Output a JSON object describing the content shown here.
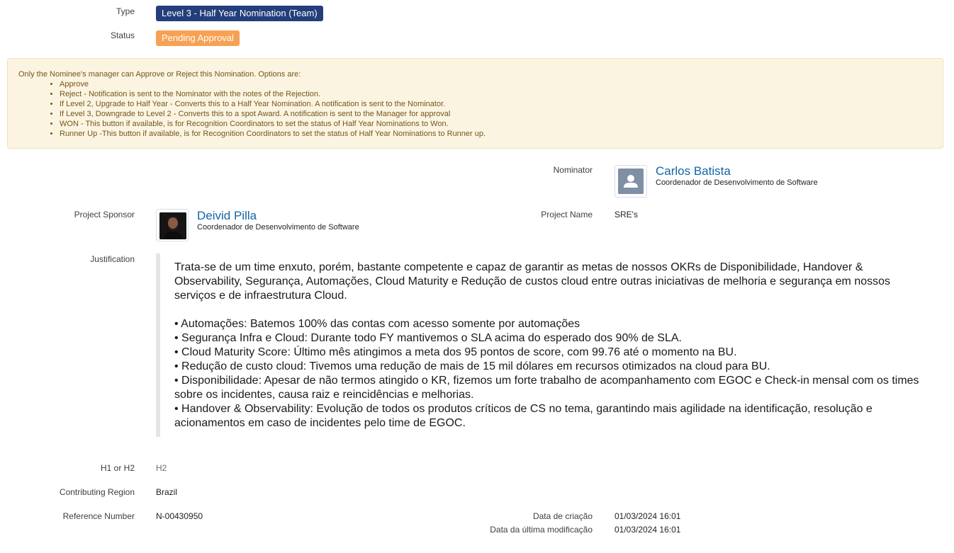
{
  "type": {
    "label": "Type",
    "value": "Level 3 - Half Year Nomination (Team)",
    "color": "#243e7b"
  },
  "status": {
    "label": "Status",
    "value": "Pending Approval",
    "color": "#f6a154"
  },
  "notice": {
    "intro": "Only the Nominee's manager can Approve or Reject this Nomination. Options are:",
    "items": [
      "Approve",
      "Reject - Notification is sent to the Nominator with the notes of the Rejection.",
      "If Level 2, Upgrade to Half Year - Converts this to a Half Year Nomination. A notification is sent to the Nominator.",
      "If Level 3, Downgrade to Level 2 - Converts this to a spot Award. A notification is sent to the Manager for approval",
      "WON - This button if available, is for Recognition Coordinators to set the status of Half Year Nominations to Won.",
      "Runner Up -This button if available, is for Recognition Coordinators to set the status of Half Year Nominations to Runner up."
    ]
  },
  "nominator": {
    "label": "Nominator",
    "name": "Carlos Batista",
    "title": "Coordenador de Desenvolvimento de Software",
    "avatar_icon": "user-placeholder-icon"
  },
  "project_sponsor": {
    "label": "Project Sponsor",
    "name": "Deivid Pilla",
    "title": "Coordenador de Desenvolvimento de Software",
    "avatar_icon": "user-photo-icon"
  },
  "project_name": {
    "label": "Project Name",
    "value": "SRE's"
  },
  "justification": {
    "label": "Justification",
    "intro": "Trata-se de um time enxuto, porém, bastante competente e capaz de garantir as metas de nossos OKRs de Disponibilidade, Handover & Observability, Segurança, Automações, Cloud Maturity e Redução de custos cloud entre outras iniciativas de melhoria e segurança em nossos serviços e de infraestrutura Cloud.",
    "bullets": [
      "• Automações: Batemos 100% das contas com acesso somente por automações",
      "• Segurança Infra e Cloud: Durante todo FY mantivemos o SLA acima do esperado dos 90% de SLA.",
      "• Cloud Maturity Score: Último mês atingimos a meta dos 95 pontos de score, com 99.76 até o momento na BU.",
      "• Redução de custo cloud: Tivemos uma redução de mais de 15 mil dólares em recursos otimizados na cloud para BU.",
      "• Disponibilidade: Apesar de não termos atingido o KR, fizemos um forte trabalho de acompanhamento com EGOC e Check-in mensal com os times sobre os incidentes, causa raiz e reincidências e melhorias.",
      "• Handover & Observability: Evolução de todos os produtos críticos de CS no tema, garantindo mais agilidade na identificação, resolução e acionamentos em caso de incidentes pelo time de EGOC."
    ]
  },
  "h1_or_h2": {
    "label": "H1 or H2",
    "value": "H2"
  },
  "contributing_region": {
    "label": "Contributing Region",
    "value": "Brazil"
  },
  "reference_number": {
    "label": "Reference Number",
    "value": "N-00430950"
  },
  "created": {
    "label": "Data de criação",
    "value": "01/03/2024 16:01"
  },
  "modified": {
    "label": "Data da última modificação",
    "value": "01/03/2024 16:01"
  }
}
